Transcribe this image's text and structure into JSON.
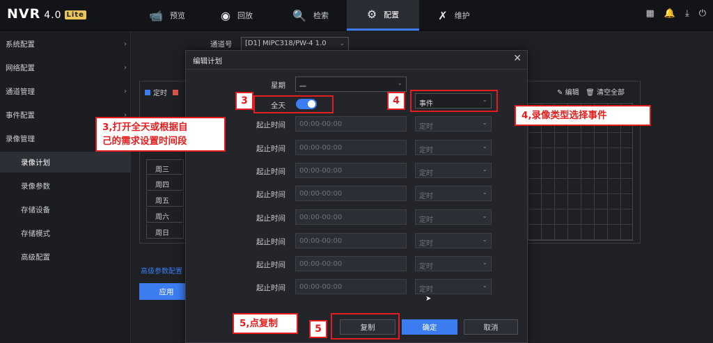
{
  "brand": {
    "name": "NVR",
    "version": "4.0",
    "edition": "Lite"
  },
  "nav": [
    {
      "label": "预览",
      "icon": "camera-icon"
    },
    {
      "label": "回放",
      "icon": "playback-icon"
    },
    {
      "label": "检索",
      "icon": "search-file-icon"
    },
    {
      "label": "配置",
      "icon": "gear-icon"
    },
    {
      "label": "维护",
      "icon": "wrench-icon"
    }
  ],
  "sidebar": [
    {
      "label": "系统配置"
    },
    {
      "label": "网络配置"
    },
    {
      "label": "通道管理"
    },
    {
      "label": "事件配置"
    },
    {
      "label": "录像管理"
    },
    {
      "label": "录像计划"
    },
    {
      "label": "录像参数"
    },
    {
      "label": "存储设备"
    },
    {
      "label": "存储模式"
    },
    {
      "label": "高级配置"
    }
  ],
  "background": {
    "channel_label": "通道号",
    "channel_value": "[D1] MIPC318/PW-4 1.0",
    "legend_timed": "定时",
    "edit_label": "编辑",
    "clear_label": "清空全部",
    "days": [
      "周三",
      "周四",
      "周五",
      "周六",
      "周日"
    ],
    "advanced_link": "高级参数配置",
    "apply_label": "应用"
  },
  "modal": {
    "title": "编辑计划",
    "week_label": "星期",
    "week_value": "一",
    "allday_label": "全天",
    "allday_on": true,
    "record_type": "事件",
    "time_label": "起止时间",
    "time_placeholder": "00:00-00:00",
    "type_placeholder": "定时",
    "copy_label": "复制",
    "ok_label": "确定",
    "cancel_label": "取消"
  },
  "annotations": {
    "n3": "3",
    "n4": "4",
    "n5": "5",
    "text3_line1": "3,打开全天或根据自",
    "text3_line2": "己的需求设置时间段",
    "text4": "4,录像类型选择事件",
    "text5": "5,点复制"
  },
  "colors": {
    "accent": "#3b7cf0",
    "annotation_red": "#e41e1e",
    "legend_red": "#d9534f"
  }
}
